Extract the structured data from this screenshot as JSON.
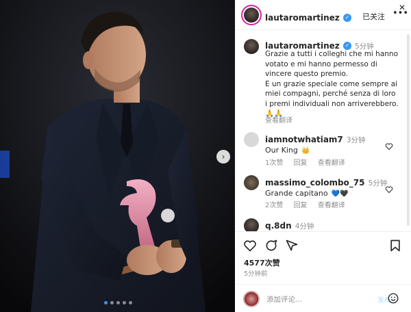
{
  "header": {
    "username": "lautaromartinez",
    "follow_status": "已关注",
    "more_icon": "more-horizontal-icon",
    "close_icon": "close-icon"
  },
  "caption": {
    "username": "lautaromartinez",
    "time": "5分钟",
    "lines": [
      "Grazie a tutti i colleghi che mi hanno",
      "votato e mi hanno permesso di",
      "vincere questo premio.",
      "E un grazie speciale come sempre ai",
      "miei compagni, perché senza di loro",
      "i premi individuali non arriverebbero."
    ],
    "emoji": "🙏🙏",
    "see_translation": "查看翻译"
  },
  "comments": [
    {
      "username": "iamnotwhatiam7",
      "time": "3分钟",
      "text": "Our King",
      "emoji": "👑",
      "likes": "1次赞",
      "reply": "回复",
      "translate": "查看翻译"
    },
    {
      "username": "massimo_colombo_75",
      "time": "5分钟",
      "text": "Grande capitano",
      "emoji": "💙🖤",
      "likes": "2次赞",
      "reply": "回复",
      "translate": "查看翻译"
    },
    {
      "username": "q.8dn",
      "time": "4分钟",
      "text": "",
      "emoji": ""
    }
  ],
  "actions": {
    "likes_count": "4577次赞",
    "posted_time": "5分钟前"
  },
  "comment_input": {
    "placeholder": "添加评论...",
    "post_label": "发布"
  },
  "carousel": {
    "dots_total": 5,
    "active_index": 0
  },
  "colors": {
    "verified_blue": "#3897f0",
    "trophy_pink": "#e88fa7",
    "background_dark": "#0b0b0e"
  }
}
